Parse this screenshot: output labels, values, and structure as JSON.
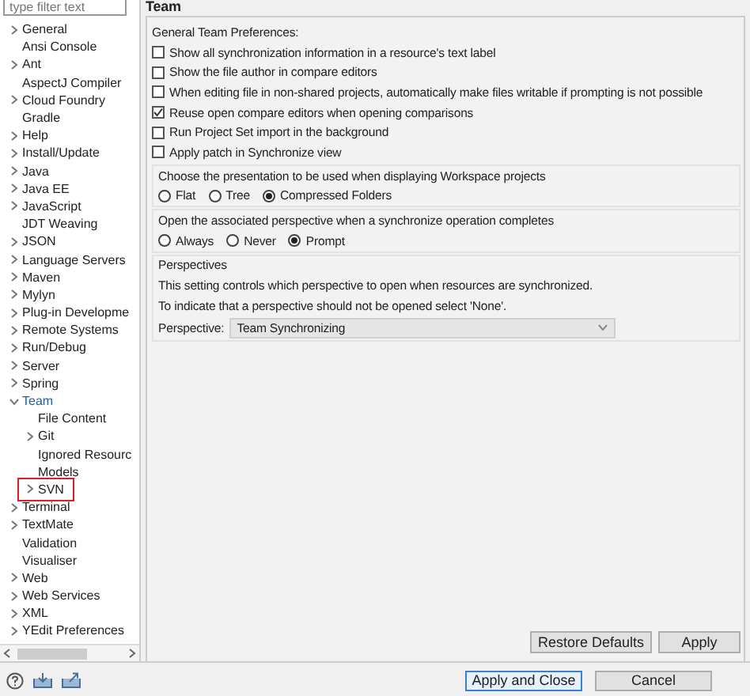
{
  "filter": {
    "placeholder": "type filter text"
  },
  "tree": [
    {
      "label": "General",
      "expanded": false,
      "selected": false
    },
    {
      "label": "Ansi Console",
      "selected": false
    },
    {
      "label": "Ant",
      "expanded": false,
      "selected": false
    },
    {
      "label": "AspectJ Compiler",
      "selected": false
    },
    {
      "label": "Cloud Foundry",
      "expanded": false,
      "selected": false
    },
    {
      "label": "Gradle",
      "selected": false
    },
    {
      "label": "Help",
      "expanded": false,
      "selected": false
    },
    {
      "label": "Install/Update",
      "expanded": false,
      "selected": false
    },
    {
      "label": "Java",
      "expanded": false,
      "selected": false
    },
    {
      "label": "Java EE",
      "expanded": false,
      "selected": false
    },
    {
      "label": "JavaScript",
      "expanded": false,
      "selected": false
    },
    {
      "label": "JDT Weaving",
      "selected": false
    },
    {
      "label": "JSON",
      "expanded": false,
      "selected": false
    },
    {
      "label": "Language Servers",
      "expanded": false,
      "selected": false
    },
    {
      "label": "Maven",
      "expanded": false,
      "selected": false
    },
    {
      "label": "Mylyn",
      "expanded": false,
      "selected": false
    },
    {
      "label": "Plug-in Developme",
      "expanded": false,
      "selected": false
    },
    {
      "label": "Remote Systems",
      "expanded": false,
      "selected": false
    },
    {
      "label": "Run/Debug",
      "expanded": false,
      "selected": false
    },
    {
      "label": "Server",
      "expanded": false,
      "selected": false
    },
    {
      "label": "Spring",
      "expanded": false,
      "selected": false
    },
    {
      "label": "Team",
      "expanded": true,
      "selected": true,
      "children": [
        {
          "label": "File Content",
          "selected": false
        },
        {
          "label": "Git",
          "expanded": false,
          "selected": false
        },
        {
          "label": "Ignored Resourc",
          "selected": false
        },
        {
          "label": "Models",
          "selected": false
        },
        {
          "label": "SVN",
          "expanded": false,
          "selected": false,
          "highlighted": true
        }
      ]
    },
    {
      "label": "Terminal",
      "expanded": false,
      "selected": false
    },
    {
      "label": "TextMate",
      "expanded": false,
      "selected": false
    },
    {
      "label": "Validation",
      "selected": false
    },
    {
      "label": "Visualiser",
      "selected": false
    },
    {
      "label": "Web",
      "expanded": false,
      "selected": false
    },
    {
      "label": "Web Services",
      "expanded": false,
      "selected": false
    },
    {
      "label": "XML",
      "expanded": false,
      "selected": false
    },
    {
      "label": "YEdit Preferences",
      "expanded": false,
      "selected": false
    }
  ],
  "page": {
    "title": "Team",
    "general_label": "General Team Preferences:",
    "options": [
      {
        "label": "Show all synchronization information in a resource's text label",
        "checked": false
      },
      {
        "label": "Show the file author in compare editors",
        "checked": false
      },
      {
        "label": "When editing file in non-shared projects, automatically make files writable if prompting is not possible",
        "checked": false
      },
      {
        "label": "Reuse open compare editors when opening comparisons",
        "checked": true
      },
      {
        "label": "Run Project Set import in the background",
        "checked": false
      },
      {
        "label": "Apply patch in Synchronize view",
        "checked": false
      }
    ],
    "presentation": {
      "label": "Choose the presentation to be used when displaying Workspace projects",
      "choices": [
        {
          "label": "Flat",
          "selected": false
        },
        {
          "label": "Tree",
          "selected": false
        },
        {
          "label": "Compressed Folders",
          "selected": true
        }
      ]
    },
    "open_perspective": {
      "label": "Open the associated perspective when a synchronize operation completes",
      "choices": [
        {
          "label": "Always",
          "selected": false
        },
        {
          "label": "Never",
          "selected": false
        },
        {
          "label": "Prompt",
          "selected": true
        }
      ]
    },
    "perspectives": {
      "title": "Perspectives",
      "description": [
        "This setting controls which perspective to open when resources are synchronized.",
        "To indicate that a perspective should not be opened select 'None'."
      ],
      "field_label": "Perspective:",
      "value": "Team Synchronizing"
    },
    "page_buttons": [
      "Restore Defaults",
      "Apply"
    ]
  },
  "dialog_buttons": [
    {
      "label": "Apply and Close",
      "default": true
    },
    {
      "label": "Cancel",
      "default": false
    }
  ]
}
